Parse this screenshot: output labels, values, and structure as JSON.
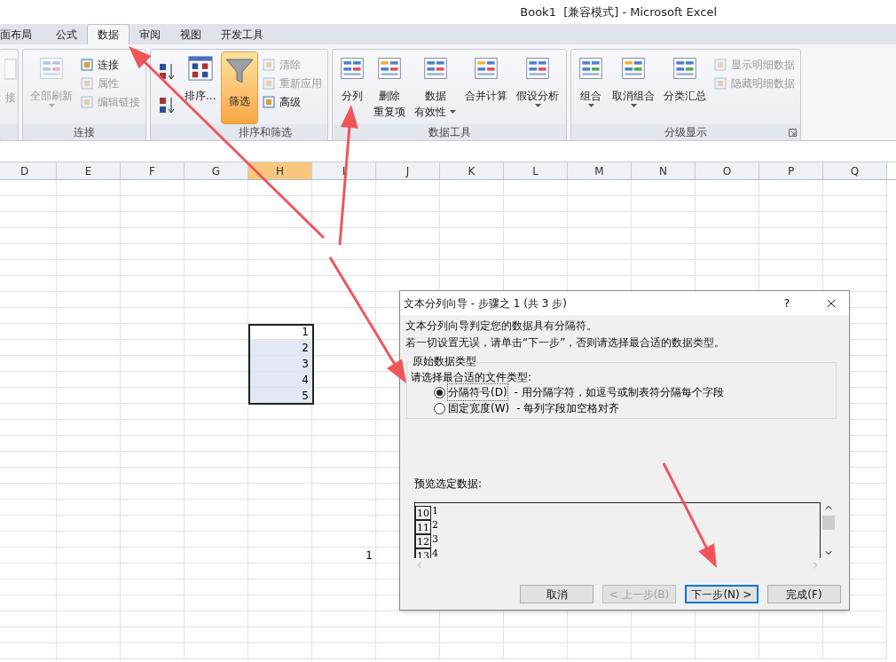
{
  "window": {
    "title": "Book1  [兼容模式] - Microsoft Excel"
  },
  "tabs": [
    {
      "label": "面布局",
      "selected": false
    },
    {
      "label": "公式",
      "selected": false
    },
    {
      "label": "数据",
      "selected": true
    },
    {
      "label": "审阅",
      "selected": false
    },
    {
      "label": "视图",
      "selected": false
    },
    {
      "label": "开发工具",
      "selected": false
    }
  ],
  "ribbon": {
    "groups": [
      {
        "columns": [
          [
            {
              "kind": "large",
              "lines": [
                "接"
              ],
              "disabled": true,
              "dropdown": false,
              "selected": false
            }
          ]
        ]
      },
      {
        "label": "连接",
        "columns": [
          [
            {
              "kind": "large",
              "lines": [
                "全部刷新"
              ],
              "disabled": true,
              "dropdown": true,
              "selected": false
            }
          ],
          [
            {
              "kind": "small",
              "label": "连接",
              "disabled": false
            },
            {
              "kind": "small",
              "label": "属性",
              "disabled": true
            },
            {
              "kind": "small",
              "label": "编辑链接",
              "disabled": true
            }
          ]
        ]
      },
      {
        "label": "排序和筛选",
        "columns": [
          [
            {
              "kind": "icon",
              "disabled": false
            },
            {
              "kind": "icon",
              "disabled": false
            }
          ],
          [
            {
              "kind": "large",
              "lines": [
                "排序..."
              ],
              "disabled": false,
              "dropdown": false,
              "selected": false
            }
          ],
          [
            {
              "kind": "large",
              "lines": [
                "筛选"
              ],
              "disabled": false,
              "dropdown": false,
              "selected": true
            }
          ],
          [
            {
              "kind": "small",
              "label": "清除",
              "disabled": true
            },
            {
              "kind": "small",
              "label": "重新应用",
              "disabled": true
            },
            {
              "kind": "small",
              "label": "高级",
              "disabled": false
            }
          ]
        ]
      },
      {
        "label": "数据工具",
        "columns": [
          [
            {
              "kind": "large",
              "lines": [
                "分列"
              ],
              "disabled": false,
              "dropdown": false,
              "selected": false
            }
          ],
          [
            {
              "kind": "large",
              "lines": [
                "删除",
                "重复项"
              ],
              "disabled": false,
              "dropdown": false,
              "selected": false
            }
          ],
          [
            {
              "kind": "large",
              "lines": [
                "数据",
                "有效性"
              ],
              "disabled": false,
              "dropdown": true,
              "selected": false
            }
          ],
          [
            {
              "kind": "large",
              "lines": [
                "合并计算"
              ],
              "disabled": false,
              "dropdown": false,
              "selected": false
            }
          ],
          [
            {
              "kind": "large",
              "lines": [
                "假设分析"
              ],
              "disabled": false,
              "dropdown": true,
              "selected": false
            }
          ]
        ]
      },
      {
        "label": "分级显示",
        "launcher": true,
        "columns": [
          [
            {
              "kind": "large",
              "lines": [
                "组合"
              ],
              "disabled": false,
              "dropdown": true,
              "selected": false
            }
          ],
          [
            {
              "kind": "large",
              "lines": [
                "取消组合"
              ],
              "disabled": false,
              "dropdown": true,
              "selected": false
            }
          ],
          [
            {
              "kind": "large",
              "lines": [
                "分类汇总"
              ],
              "disabled": false,
              "dropdown": false,
              "selected": false
            }
          ],
          [
            {
              "kind": "small",
              "label": "显示明细数据",
              "disabled": true
            },
            {
              "kind": "small",
              "label": "隐藏明细数据",
              "disabled": true
            }
          ]
        ]
      }
    ]
  },
  "sheet": {
    "columns": [
      {
        "label": "D",
        "selected": false
      },
      {
        "label": "E",
        "selected": false
      },
      {
        "label": "F",
        "selected": false
      },
      {
        "label": "G",
        "selected": false
      },
      {
        "label": "H",
        "selected": true
      },
      {
        "label": "I",
        "selected": false
      },
      {
        "label": "J",
        "selected": false
      },
      {
        "label": "K",
        "selected": false
      },
      {
        "label": "L",
        "selected": false
      },
      {
        "label": "M",
        "selected": false
      },
      {
        "label": "N",
        "selected": false
      },
      {
        "label": "O",
        "selected": false
      },
      {
        "label": "P",
        "selected": false
      },
      {
        "label": "Q",
        "selected": false
      }
    ],
    "rows": [
      {},
      {},
      {},
      {},
      {},
      {},
      {},
      {},
      {},
      {
        "H": {
          "value": "1",
          "selected": false
        }
      },
      {
        "H": {
          "value": "2",
          "selected": true
        }
      },
      {
        "H": {
          "value": "3",
          "selected": true
        }
      },
      {
        "H": {
          "value": "4",
          "selected": true
        }
      },
      {
        "H": {
          "value": "5",
          "selected": true
        }
      },
      {},
      {},
      {},
      {},
      {},
      {},
      {},
      {},
      {},
      {
        "I": {
          "value": "1",
          "selected": false
        }
      },
      {},
      {},
      {},
      {},
      {},
      {}
    ]
  },
  "dialog": {
    "title": "文本分列向导 - 步骤之 1 (共 3 步)",
    "help": "?",
    "messages": [
      "文本分列向导判定您的数据具有分隔符。",
      "若一切设置无误，请单击“下一步”，否则请选择最合适的数据类型。"
    ],
    "group_label": "原始数据类型",
    "prompt": "请选择最合适的文件类型:",
    "options": [
      {
        "label": "分隔符号(D)",
        "description": "- 用分隔字符，如逗号或制表符分隔每个字段",
        "selected": true
      },
      {
        "label": "固定宽度(W)",
        "description": "- 每列字段加空格对齐",
        "selected": false
      }
    ],
    "preview_label": "预览选定数据:",
    "preview_rows": [
      {
        "number": "10",
        "text": "1"
      },
      {
        "number": "11",
        "text": "2"
      },
      {
        "number": "12",
        "text": "3"
      },
      {
        "number": "13",
        "text": "4"
      }
    ],
    "buttons": [
      {
        "label": "取消",
        "disabled": false,
        "default": false
      },
      {
        "label": "< 上一步(B)",
        "disabled": true,
        "default": false
      },
      {
        "label": "下一步(N) >",
        "disabled": false,
        "default": true
      },
      {
        "label": "完成(F)",
        "disabled": false,
        "default": false
      }
    ]
  }
}
